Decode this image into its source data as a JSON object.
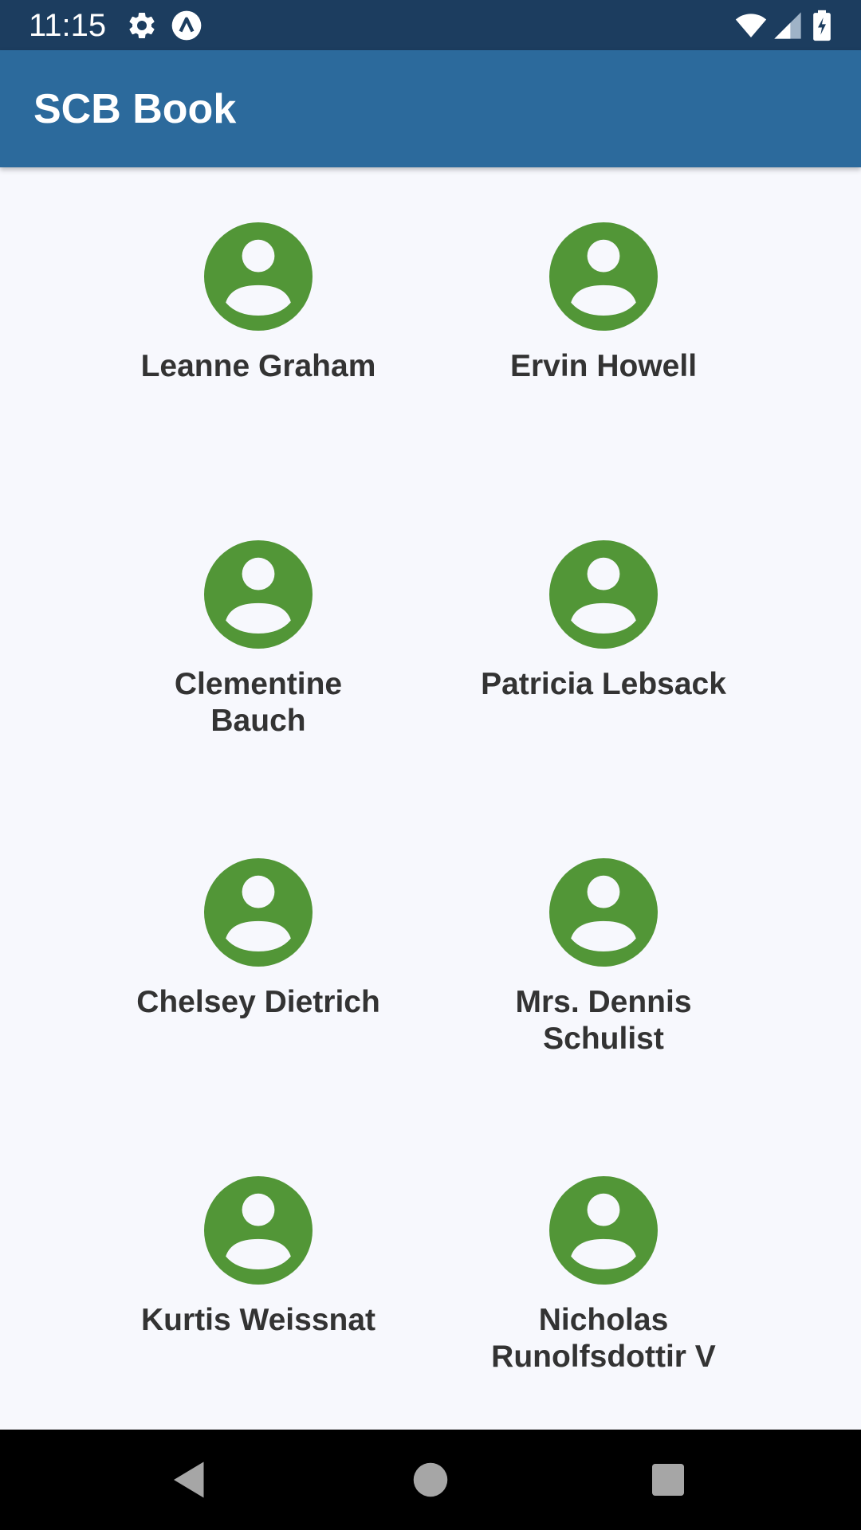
{
  "status_bar": {
    "time": "11:15",
    "icons_left": [
      "settings-icon",
      "app-notification-icon"
    ],
    "icons_right": [
      "wifi-icon",
      "cell-signal-icon",
      "battery-charging-icon"
    ]
  },
  "app_bar": {
    "title": "SCB Book",
    "color": "#2c6a9c"
  },
  "contacts": [
    {
      "name": "Leanne Graham"
    },
    {
      "name": "Ervin Howell"
    },
    {
      "name": "Clementine Bauch"
    },
    {
      "name": "Patricia Lebsack"
    },
    {
      "name": "Chelsey Dietrich"
    },
    {
      "name": "Mrs. Dennis Schulist"
    },
    {
      "name": "Kurtis Weissnat"
    },
    {
      "name": "Nicholas Runolfsdottir V"
    }
  ],
  "avatar_color": "#529637",
  "nav_bar": {
    "buttons": [
      "back-icon",
      "home-icon",
      "recents-icon"
    ]
  }
}
